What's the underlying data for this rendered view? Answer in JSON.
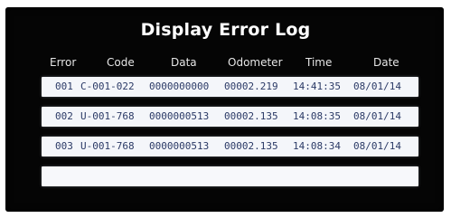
{
  "screen": {
    "title": "Display Error Log",
    "columns": {
      "error": "Error",
      "code": "Code",
      "data": "Data",
      "odometer": "Odometer",
      "time": "Time",
      "date": "Date"
    },
    "rows": [
      {
        "error": "001",
        "code": "C-001-022",
        "data": "0000000000",
        "odometer": "00002.219",
        "time": "14:41:35",
        "date": "08/01/14"
      },
      {
        "error": "002",
        "code": "U-001-768",
        "data": "0000000513",
        "odometer": "00002.135",
        "time": "14:08:35",
        "date": "08/01/14"
      },
      {
        "error": "003",
        "code": "U-001-768",
        "data": "0000000513",
        "odometer": "00002.135",
        "time": "14:08:34",
        "date": "08/01/14"
      }
    ]
  },
  "colors": {
    "screen_bg": "#050505",
    "row_bg": "#f4f6fa",
    "row_text": "#2b3a66",
    "header_text": "#e6e6e6"
  }
}
